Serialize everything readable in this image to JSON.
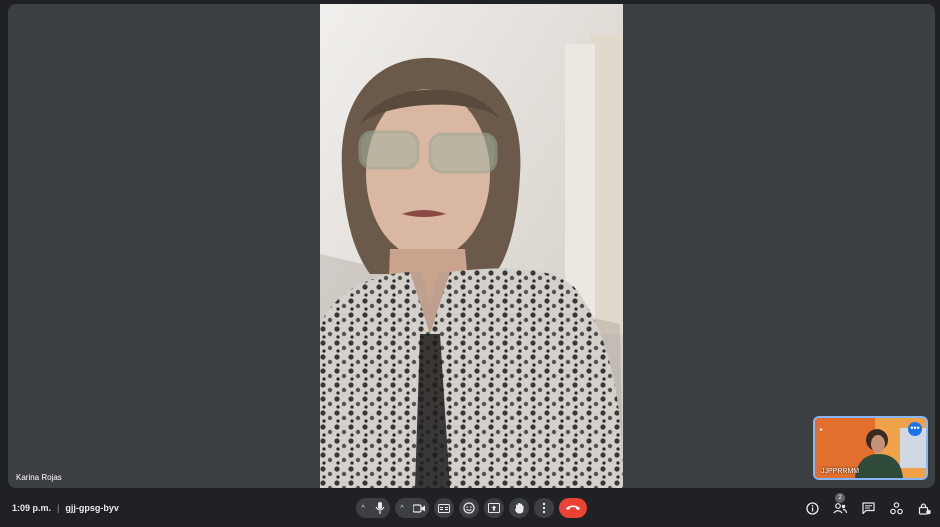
{
  "participant": {
    "name": "Karina Rojas"
  },
  "self_view": {
    "name": "JJPPRRMM"
  },
  "footer": {
    "time": "1:09 p.m.",
    "meeting_code": "gjj-gpsg-byv"
  },
  "people": {
    "count": "2"
  },
  "colors": {
    "end_call": "#ea4335",
    "self_border": "#8ab4f8",
    "background": "#202124"
  }
}
